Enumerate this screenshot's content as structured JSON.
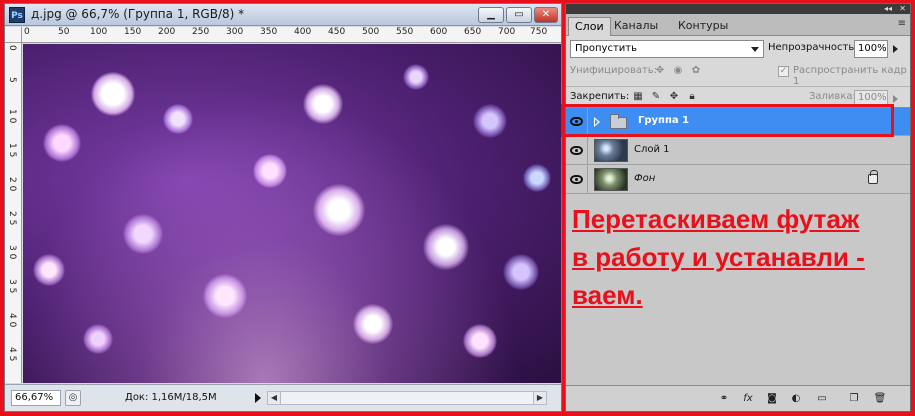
{
  "document": {
    "title": "д.jpg @ 66,7% (Группа 1, RGB/8) *",
    "app_badge": "Ps",
    "ruler_top_labels": [
      "0",
      "50",
      "100",
      "150",
      "200",
      "250",
      "300",
      "350",
      "400",
      "450",
      "500",
      "550",
      "600",
      "650",
      "700",
      "750"
    ],
    "ruler_left_labels": [
      "0",
      "5",
      "1 0",
      "1 5",
      "2 0",
      "2 5",
      "3 0",
      "3 5",
      "4 0",
      "4 5"
    ],
    "zoom": "66,67%",
    "status": "Док: 1,16M/18,5M"
  },
  "window_buttons": {
    "minimize": "▁",
    "restore": "▭",
    "close": "✕"
  },
  "panel": {
    "tabs": [
      "Слои",
      "Каналы",
      "Контуры"
    ],
    "active_tab": 0,
    "blend_mode": "Пропустить",
    "opacity_label": "Непрозрачность:",
    "opacity_value": "100%",
    "unify_label": "Унифицировать:",
    "propagate_label": "Распространить кадр 1",
    "lock_label": "Закрепить:",
    "fill_label": "Заливка:",
    "fill_value": "100%",
    "layers": [
      {
        "name": "Группа 1",
        "type": "group",
        "selected": true
      },
      {
        "name": "Слой 1",
        "type": "layer",
        "selected": false
      },
      {
        "name": "Фон",
        "type": "background",
        "selected": false
      }
    ]
  },
  "annotation": {
    "lines": [
      "Перетаскиваем футаж",
      "в работу и устанавли -",
      "ваем."
    ],
    "color": "#e8101a"
  },
  "colors": {
    "accent_red": "#e8101a",
    "selection_blue": "#3d8df2"
  },
  "icons": {
    "footer": [
      "link-icon",
      "fx-icon",
      "mask-icon",
      "adjustment-icon",
      "folder-icon",
      "new-layer-icon",
      "trash-icon"
    ]
  }
}
